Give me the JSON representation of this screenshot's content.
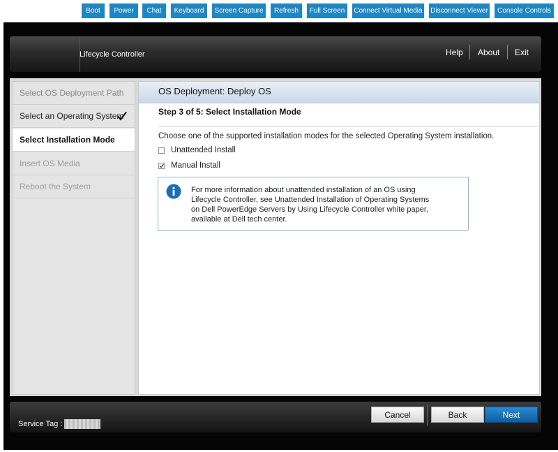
{
  "toolbar": {
    "buttons": [
      "Boot",
      "Power",
      "Chat",
      "Keyboard",
      "Screen Capture",
      "Refresh",
      "Full Screen",
      "Connect Virtual Media",
      "Disconnect Viewer",
      "Console Controls"
    ]
  },
  "header": {
    "app_title": "Lifecycle Controller",
    "links": {
      "help": "Help",
      "about": "About",
      "exit": "Exit"
    }
  },
  "sidebar": {
    "steps": [
      {
        "label": "Select OS Deployment Path",
        "state": "done"
      },
      {
        "label": "Select an Operating System",
        "state": "completed"
      },
      {
        "label": "Select Installation Mode",
        "state": "active"
      },
      {
        "label": "Insert OS Media",
        "state": "pending"
      },
      {
        "label": "Reboot the System",
        "state": "pending"
      }
    ]
  },
  "main": {
    "panel_title": "OS Deployment: Deploy OS",
    "step_title": "Step 3 of 5: Select Installation Mode",
    "instructions": "Choose one of the supported installation modes for the selected Operating System installation.",
    "options": [
      {
        "label": "Unattended Install",
        "checked": false
      },
      {
        "label": "Manual Install",
        "checked": true
      }
    ],
    "info_lines": [
      "For more information about unattended installation of an OS using",
      "Lifecycle Controller, see Unattended Installation of Operating Systems",
      "on Dell PowerEdge Servers by Using Lifecycle Controller white paper,",
      "available at Dell tech center."
    ]
  },
  "footer": {
    "service_tag_label": "Service Tag :",
    "buttons": {
      "cancel": "Cancel",
      "back": "Back",
      "next": "Next"
    }
  },
  "colors": {
    "toolbar_button": "#1f86c4",
    "primary_button": "#0d5fa6",
    "info_icon": "#1a6fb5"
  }
}
